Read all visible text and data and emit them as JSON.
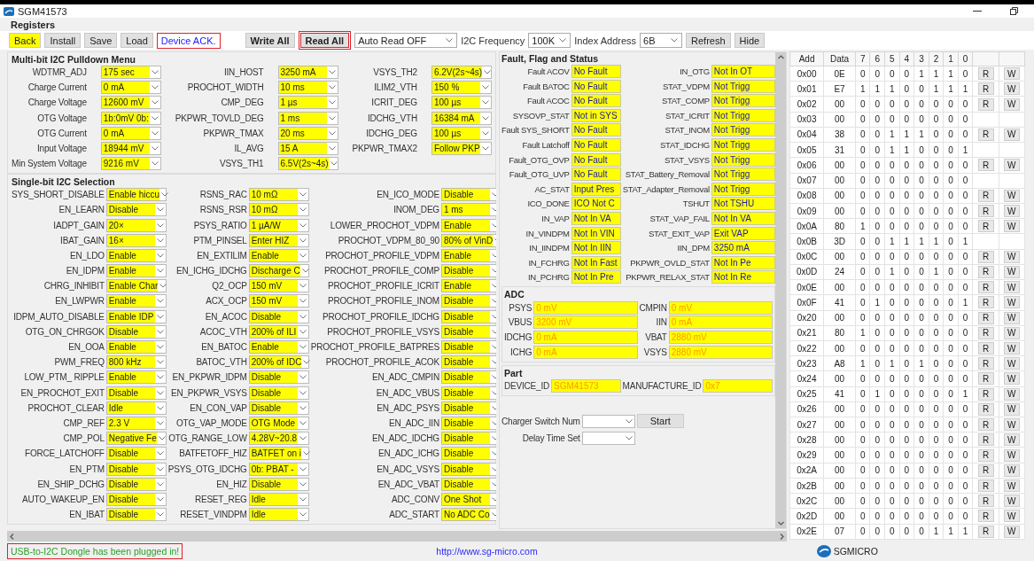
{
  "window": {
    "title": "SGM41573"
  },
  "section_title": "Registers",
  "toolbar": [
    {
      "kind": "button",
      "label": "Back",
      "highlight": true,
      "bold": false,
      "outlined": false
    },
    {
      "kind": "button",
      "label": "Install",
      "highlight": false,
      "bold": false,
      "outlined": false
    },
    {
      "kind": "button",
      "label": "Save",
      "highlight": false,
      "bold": false,
      "outlined": false
    },
    {
      "kind": "button",
      "label": "Load",
      "highlight": false,
      "bold": false,
      "outlined": false
    },
    {
      "kind": "message",
      "text": "Device ACK.",
      "outlined": true
    },
    {
      "kind": "spacer"
    },
    {
      "kind": "button",
      "label": "Write All",
      "highlight": false,
      "bold": true,
      "outlined": false
    },
    {
      "kind": "button",
      "label": "Read All",
      "highlight": false,
      "bold": true,
      "outlined": true
    },
    {
      "kind": "combo",
      "value": "Auto Read OFF"
    },
    {
      "kind": "label",
      "text": "I2C Frequency"
    },
    {
      "kind": "combo",
      "value": "100K"
    },
    {
      "kind": "label",
      "text": "Index Address"
    },
    {
      "kind": "combo",
      "value": "6B"
    },
    {
      "kind": "button",
      "label": "Refresh",
      "highlight": false,
      "bold": false,
      "outlined": false
    },
    {
      "kind": "button",
      "label": "Hide",
      "highlight": false,
      "bold": false,
      "outlined": false
    }
  ],
  "multi_bit": {
    "title": "Multi-bit I2C Pulldown Menu",
    "items": [
      {
        "label": "WDTMR_ADJ",
        "value": "175 sec"
      },
      {
        "label": "IIN_HOST",
        "value": "3250 mA"
      },
      {
        "label": "VSYS_TH2",
        "value": "6.2V(2s~4s)"
      },
      {
        "label": "Charge Current",
        "value": "0 mA"
      },
      {
        "label": "PROCHOT_WIDTH",
        "value": "10 ms"
      },
      {
        "label": "ILIM2_VTH",
        "value": "150 %"
      },
      {
        "label": "Charge Voltage",
        "value": "12600 mV"
      },
      {
        "label": "CMP_DEG",
        "value": "1 µs"
      },
      {
        "label": "ICRIT_DEG",
        "value": "100 µs"
      },
      {
        "label": "OTG Voltage",
        "value": "1b:0mV 0b:"
      },
      {
        "label": "PKPWR_TOVLD_DEG",
        "value": "1 ms"
      },
      {
        "label": "IDCHG_VTH",
        "value": "16384 mA"
      },
      {
        "label": "OTG Current",
        "value": "0 mA"
      },
      {
        "label": "PKPWR_TMAX",
        "value": "20 ms"
      },
      {
        "label": "IDCHG_DEG",
        "value": "100 µs"
      },
      {
        "label": "Input Voltage",
        "value": "18944 mV"
      },
      {
        "label": "IL_AVG",
        "value": "15 A"
      },
      {
        "label": "PKPWR_TMAX2",
        "value": "Follow PKP"
      },
      {
        "label": "Min System Voltage",
        "value": "9216 mV"
      },
      {
        "label": "VSYS_TH1",
        "value": "6.5V(2s~4s)"
      }
    ]
  },
  "single_bit": {
    "title": "Single-bit I2C Selection",
    "items": [
      {
        "label": "SYS_SHORT_DISABLE",
        "value": "Enable hiccu"
      },
      {
        "label": "RSNS_RAC",
        "value": "10 mΩ"
      },
      {
        "label": "EN_ICO_MODE",
        "value": "Disable"
      },
      {
        "label": "EN_LEARN",
        "value": "Disable"
      },
      {
        "label": "RSNS_RSR",
        "value": "10 mΩ"
      },
      {
        "label": "INOM_DEG",
        "value": "1 ms"
      },
      {
        "label": "IADPT_GAIN",
        "value": "20×"
      },
      {
        "label": "PSYS_RATIO",
        "value": "1 µA/W"
      },
      {
        "label": "LOWER_PROCHOT_VDPM",
        "value": "Enable"
      },
      {
        "label": "IBAT_GAIN",
        "value": "16×"
      },
      {
        "label": "PTM_PINSEL",
        "value": "Enter HIZ"
      },
      {
        "label": "PROCHOT_VDPM_80_90",
        "value": "80% of VinD"
      },
      {
        "label": "EN_LDO",
        "value": "Enable"
      },
      {
        "label": "EN_EXTILIM",
        "value": "Enable"
      },
      {
        "label": "PROCHOT_PROFILE_VDPM",
        "value": "Enable"
      },
      {
        "label": "EN_IDPM",
        "value": "Enable"
      },
      {
        "label": "EN_ICHG_IDCHG",
        "value": "Discharge C"
      },
      {
        "label": "PROCHOT_PROFILE_COMP",
        "value": "Disable"
      },
      {
        "label": "CHRG_INHIBIT",
        "value": "Enable Char"
      },
      {
        "label": "Q2_OCP",
        "value": "150 mV"
      },
      {
        "label": "PROCHOT_PROFILE_ICRIT",
        "value": "Enable"
      },
      {
        "label": "EN_LWPWR",
        "value": "Enable"
      },
      {
        "label": "ACX_OCP",
        "value": "150 mV"
      },
      {
        "label": "PROCHOT_PROFILE_INOM",
        "value": "Disable"
      },
      {
        "label": "IDPM_AUTO_DISABLE",
        "value": "Enable IDP"
      },
      {
        "label": "EN_ACOC",
        "value": "Disable"
      },
      {
        "label": "PROCHOT_PROFILE_IDCHG",
        "value": "Disable"
      },
      {
        "label": "OTG_ON_CHRGOK",
        "value": "Disable"
      },
      {
        "label": "ACOC_VTH",
        "value": "200% of ILI"
      },
      {
        "label": "PROCHOT_PROFILE_VSYS",
        "value": "Disable"
      },
      {
        "label": "EN_OOA",
        "value": "Enable"
      },
      {
        "label": "EN_BATOC",
        "value": "Enable"
      },
      {
        "label": "PROCHOT_PROFILE_BATPRES",
        "value": "Disable"
      },
      {
        "label": "PWM_FREQ",
        "value": "800 kHz"
      },
      {
        "label": "BATOC_VTH",
        "value": "200% of IDC"
      },
      {
        "label": "PROCHOT_PROFILE_ACOK",
        "value": "Disable"
      },
      {
        "label": "LOW_PTM_ RIPPLE",
        "value": "Enable"
      },
      {
        "label": "EN_PKPWR_IDPM",
        "value": "Disable"
      },
      {
        "label": "EN_ADC_CMPIN",
        "value": "Disable"
      },
      {
        "label": "EN_PROCHOT_EXIT",
        "value": "Disable"
      },
      {
        "label": "EN_PKPWR_VSYS",
        "value": "Disable"
      },
      {
        "label": "EN_ADC_VBUS",
        "value": "Disable"
      },
      {
        "label": "PROCHOT_CLEAR",
        "value": "Idle"
      },
      {
        "label": "EN_CON_VAP",
        "value": "Disable"
      },
      {
        "label": "EN_ADC_PSYS",
        "value": "Disable"
      },
      {
        "label": "CMP_REF",
        "value": "2.3 V"
      },
      {
        "label": "OTG_VAP_MODE",
        "value": "OTG Mode"
      },
      {
        "label": "EN_ADC_IIN",
        "value": "Disable"
      },
      {
        "label": "CMP_POL",
        "value": "Negative Fe"
      },
      {
        "label": "OTG_RANGE_LOW",
        "value": "4.28V~20.8"
      },
      {
        "label": "EN_ADC_IDCHG",
        "value": "Disable"
      },
      {
        "label": "FORCE_LATCHOFF",
        "value": "Disable"
      },
      {
        "label": "BATFETOFF_HIZ",
        "value": "BATFET on i"
      },
      {
        "label": "EN_ADC_ICHG",
        "value": "Disable"
      },
      {
        "label": "EN_PTM",
        "value": "Disable"
      },
      {
        "label": "PSYS_OTG_IDCHG",
        "value": "0b: PBAT -"
      },
      {
        "label": "EN_ADC_VSYS",
        "value": "Disable"
      },
      {
        "label": "EN_SHIP_DCHG",
        "value": "Disable"
      },
      {
        "label": "EN_HIZ",
        "value": "Disable"
      },
      {
        "label": "EN_ADC_VBAT",
        "value": "Disable"
      },
      {
        "label": "AUTO_WAKEUP_EN",
        "value": "Disable"
      },
      {
        "label": "RESET_REG",
        "value": "Idle"
      },
      {
        "label": "ADC_CONV",
        "value": "One Shot"
      },
      {
        "label": "EN_IBAT",
        "value": "Disable"
      },
      {
        "label": "RESET_VINDPM",
        "value": "Idle"
      },
      {
        "label": "ADC_START",
        "value": "No ADC Co"
      }
    ]
  },
  "fault": {
    "title": "Fault, Flag and Status",
    "items": [
      {
        "label": "Fault ACOV",
        "value": "No Fault"
      },
      {
        "label": "IN_OTG",
        "value": "Not In OT"
      },
      {
        "label": "Fault BATOC",
        "value": "No Fault"
      },
      {
        "label": "STAT_VDPM",
        "value": "Not Trigg"
      },
      {
        "label": "Fault ACOC",
        "value": "No Fault"
      },
      {
        "label": "STAT_COMP",
        "value": "Not Trigg"
      },
      {
        "label": "SYSOVP_STAT",
        "value": "Not in SYS"
      },
      {
        "label": "STAT_ICRIT",
        "value": "Not Trigg"
      },
      {
        "label": "Fault SYS_SHORT",
        "value": "No Fault"
      },
      {
        "label": "STAT_INOM",
        "value": "Not Trigg"
      },
      {
        "label": "Fault Latchoff",
        "value": "No Fault"
      },
      {
        "label": "STAT_IDCHG",
        "value": "Not Trigg"
      },
      {
        "label": "Fault_OTG_OVP",
        "value": "No Fault"
      },
      {
        "label": "STAT_VSYS",
        "value": "Not Trigg"
      },
      {
        "label": "Fault_OTG_UVP",
        "value": "No Fault"
      },
      {
        "label": "STAT_Battery_Removal",
        "value": "Not Trigg"
      },
      {
        "label": "AC_STAT",
        "value": "Input Pres"
      },
      {
        "label": "STAT_Adapter_Removal",
        "value": "Not Trigg"
      },
      {
        "label": "ICO_DONE",
        "value": "ICO Not C"
      },
      {
        "label": "TSHUT",
        "value": "Not TSHU"
      },
      {
        "label": "IN_VAP",
        "value": "Not In VA"
      },
      {
        "label": "STAT_VAP_FAIL",
        "value": "Not In VA"
      },
      {
        "label": "IN_VINDPM",
        "value": "Not In VIN"
      },
      {
        "label": "STAT_EXIT_VAP",
        "value": "Exit VAP"
      },
      {
        "label": "IN_IINDPM",
        "value": "Not In IIN"
      },
      {
        "label": "IIN_DPM",
        "value": "3250 mA"
      },
      {
        "label": "IN_FCHRG",
        "value": "Not In Fast"
      },
      {
        "label": "PKPWR_OVLD_STAT",
        "value": "Not In Pe"
      },
      {
        "label": "IN_PCHRG",
        "value": "Not In Pre"
      },
      {
        "label": "PKPWR_RELAX_STAT",
        "value": "Not In Re"
      }
    ]
  },
  "adc": {
    "title": "ADC",
    "items": [
      {
        "label": "PSYS",
        "value": "0 mV"
      },
      {
        "label": "CMPIN",
        "value": "0 mV"
      },
      {
        "label": "VBUS",
        "value": "3200 mV"
      },
      {
        "label": "IIN",
        "value": "0 mA"
      },
      {
        "label": "IDCHG",
        "value": "0 mA"
      },
      {
        "label": "VBAT",
        "value": "2880 mV"
      },
      {
        "label": "ICHG",
        "value": "0 mA"
      },
      {
        "label": "VSYS",
        "value": "2880 mV"
      }
    ]
  },
  "part": {
    "title": "Part",
    "items": [
      {
        "label": "DEVICE_ID",
        "value": "SGM41573"
      },
      {
        "label": "MANUFACTURE_ID",
        "value": "0x7"
      }
    ]
  },
  "charger": {
    "rows": [
      {
        "label": "Charger Switch Num"
      },
      {
        "label": "Delay Time Set"
      }
    ],
    "button": "Start"
  },
  "registers": {
    "columns": [
      "Add",
      "Data",
      "7",
      "6",
      "5",
      "4",
      "3",
      "2",
      "1",
      "0"
    ],
    "rows": [
      {
        "addr": "0x00",
        "data": "0E",
        "bits": [
          "0",
          "0",
          "0",
          "0",
          "1",
          "1",
          "1",
          "0"
        ],
        "actions": [
          "R",
          "W"
        ]
      },
      {
        "addr": "0x01",
        "data": "E7",
        "bits": [
          "1",
          "1",
          "1",
          "0",
          "0",
          "1",
          "1",
          "1"
        ],
        "actions": [
          "R",
          "W"
        ]
      },
      {
        "addr": "0x02",
        "data": "00",
        "bits": [
          "0",
          "0",
          "0",
          "0",
          "0",
          "0",
          "0",
          "0"
        ],
        "actions": [
          "R",
          "W"
        ]
      },
      {
        "addr": "0x03",
        "data": "00",
        "bits": [
          "0",
          "0",
          "0",
          "0",
          "0",
          "0",
          "0",
          "0"
        ]
      },
      {
        "addr": "0x04",
        "data": "38",
        "bits": [
          "0",
          "0",
          "1",
          "1",
          "1",
          "0",
          "0",
          "0"
        ],
        "actions": [
          "R",
          "W"
        ]
      },
      {
        "addr": "0x05",
        "data": "31",
        "bits": [
          "0",
          "0",
          "1",
          "1",
          "0",
          "0",
          "0",
          "1"
        ]
      },
      {
        "addr": "0x06",
        "data": "00",
        "bits": [
          "0",
          "0",
          "0",
          "0",
          "0",
          "0",
          "0",
          "0"
        ],
        "actions": [
          "R",
          "W"
        ]
      },
      {
        "addr": "0x07",
        "data": "00",
        "bits": [
          "0",
          "0",
          "0",
          "0",
          "0",
          "0",
          "0",
          "0"
        ]
      },
      {
        "addr": "0x08",
        "data": "00",
        "bits": [
          "0",
          "0",
          "0",
          "0",
          "0",
          "0",
          "0",
          "0"
        ],
        "actions": [
          "R",
          "W"
        ]
      },
      {
        "addr": "0x09",
        "data": "00",
        "bits": [
          "0",
          "0",
          "0",
          "0",
          "0",
          "0",
          "0",
          "0"
        ],
        "actions": [
          "R",
          "W"
        ]
      },
      {
        "addr": "0x0A",
        "data": "80",
        "bits": [
          "1",
          "0",
          "0",
          "0",
          "0",
          "0",
          "0",
          "0"
        ],
        "actions": [
          "R",
          "W"
        ]
      },
      {
        "addr": "0x0B",
        "data": "3D",
        "bits": [
          "0",
          "0",
          "1",
          "1",
          "1",
          "1",
          "0",
          "1"
        ]
      },
      {
        "addr": "0x0C",
        "data": "00",
        "bits": [
          "0",
          "0",
          "0",
          "0",
          "0",
          "0",
          "0",
          "0"
        ],
        "actions": [
          "R",
          "W"
        ]
      },
      {
        "addr": "0x0D",
        "data": "24",
        "bits": [
          "0",
          "0",
          "1",
          "0",
          "0",
          "1",
          "0",
          "0"
        ],
        "actions": [
          "R",
          "W"
        ]
      },
      {
        "addr": "0x0E",
        "data": "00",
        "bits": [
          "0",
          "0",
          "0",
          "0",
          "0",
          "0",
          "0",
          "0"
        ],
        "actions": [
          "R",
          "W"
        ]
      },
      {
        "addr": "0x0F",
        "data": "41",
        "bits": [
          "0",
          "1",
          "0",
          "0",
          "0",
          "0",
          "0",
          "1"
        ],
        "actions": [
          "R",
          "W"
        ]
      },
      {
        "addr": "0x20",
        "data": "00",
        "bits": [
          "0",
          "0",
          "0",
          "0",
          "0",
          "0",
          "0",
          "0"
        ],
        "actions": [
          "R",
          "W"
        ]
      },
      {
        "addr": "0x21",
        "data": "80",
        "bits": [
          "1",
          "0",
          "0",
          "0",
          "0",
          "0",
          "0",
          "0"
        ],
        "actions": [
          "R",
          "W"
        ]
      },
      {
        "addr": "0x22",
        "data": "00",
        "bits": [
          "0",
          "0",
          "0",
          "0",
          "0",
          "0",
          "0",
          "0"
        ],
        "actions": [
          "R",
          "W"
        ]
      },
      {
        "addr": "0x23",
        "data": "A8",
        "bits": [
          "1",
          "0",
          "1",
          "0",
          "1",
          "0",
          "0",
          "0"
        ],
        "actions": [
          "R",
          "W"
        ]
      },
      {
        "addr": "0x24",
        "data": "00",
        "bits": [
          "0",
          "0",
          "0",
          "0",
          "0",
          "0",
          "0",
          "0"
        ],
        "actions": [
          "R",
          "W"
        ]
      },
      {
        "addr": "0x25",
        "data": "41",
        "bits": [
          "0",
          "1",
          "0",
          "0",
          "0",
          "0",
          "0",
          "1"
        ],
        "actions": [
          "R",
          "W"
        ]
      },
      {
        "addr": "0x26",
        "data": "00",
        "bits": [
          "0",
          "0",
          "0",
          "0",
          "0",
          "0",
          "0",
          "0"
        ],
        "actions": [
          "R",
          "W"
        ]
      },
      {
        "addr": "0x27",
        "data": "00",
        "bits": [
          "0",
          "0",
          "0",
          "0",
          "0",
          "0",
          "0",
          "0"
        ],
        "actions": [
          "R",
          "W"
        ]
      },
      {
        "addr": "0x28",
        "data": "00",
        "bits": [
          "0",
          "0",
          "0",
          "0",
          "0",
          "0",
          "0",
          "0"
        ],
        "actions": [
          "R",
          "W"
        ]
      },
      {
        "addr": "0x29",
        "data": "00",
        "bits": [
          "0",
          "0",
          "0",
          "0",
          "0",
          "0",
          "0",
          "0"
        ],
        "actions": [
          "R",
          "W"
        ]
      },
      {
        "addr": "0x2A",
        "data": "00",
        "bits": [
          "0",
          "0",
          "0",
          "0",
          "0",
          "0",
          "0",
          "0"
        ],
        "actions": [
          "R",
          "W"
        ]
      },
      {
        "addr": "0x2B",
        "data": "00",
        "bits": [
          "0",
          "0",
          "0",
          "0",
          "0",
          "0",
          "0",
          "0"
        ],
        "actions": [
          "R",
          "W"
        ]
      },
      {
        "addr": "0x2C",
        "data": "00",
        "bits": [
          "0",
          "0",
          "0",
          "0",
          "0",
          "0",
          "0",
          "0"
        ],
        "actions": [
          "R",
          "W"
        ]
      },
      {
        "addr": "0x2D",
        "data": "00",
        "bits": [
          "0",
          "0",
          "0",
          "0",
          "0",
          "0",
          "0",
          "0"
        ],
        "actions": [
          "R",
          "W"
        ]
      },
      {
        "addr": "0x2E",
        "data": "07",
        "bits": [
          "0",
          "0",
          "0",
          "0",
          "0",
          "1",
          "1",
          "1"
        ],
        "actions": [
          "R",
          "W"
        ]
      }
    ]
  },
  "status_bar": {
    "message": {
      "text": "USB-to-I2C Dongle has been plugged in!",
      "outlined": true
    },
    "link": "http://www.sg-micro.com",
    "brand": "SGMICRO"
  }
}
